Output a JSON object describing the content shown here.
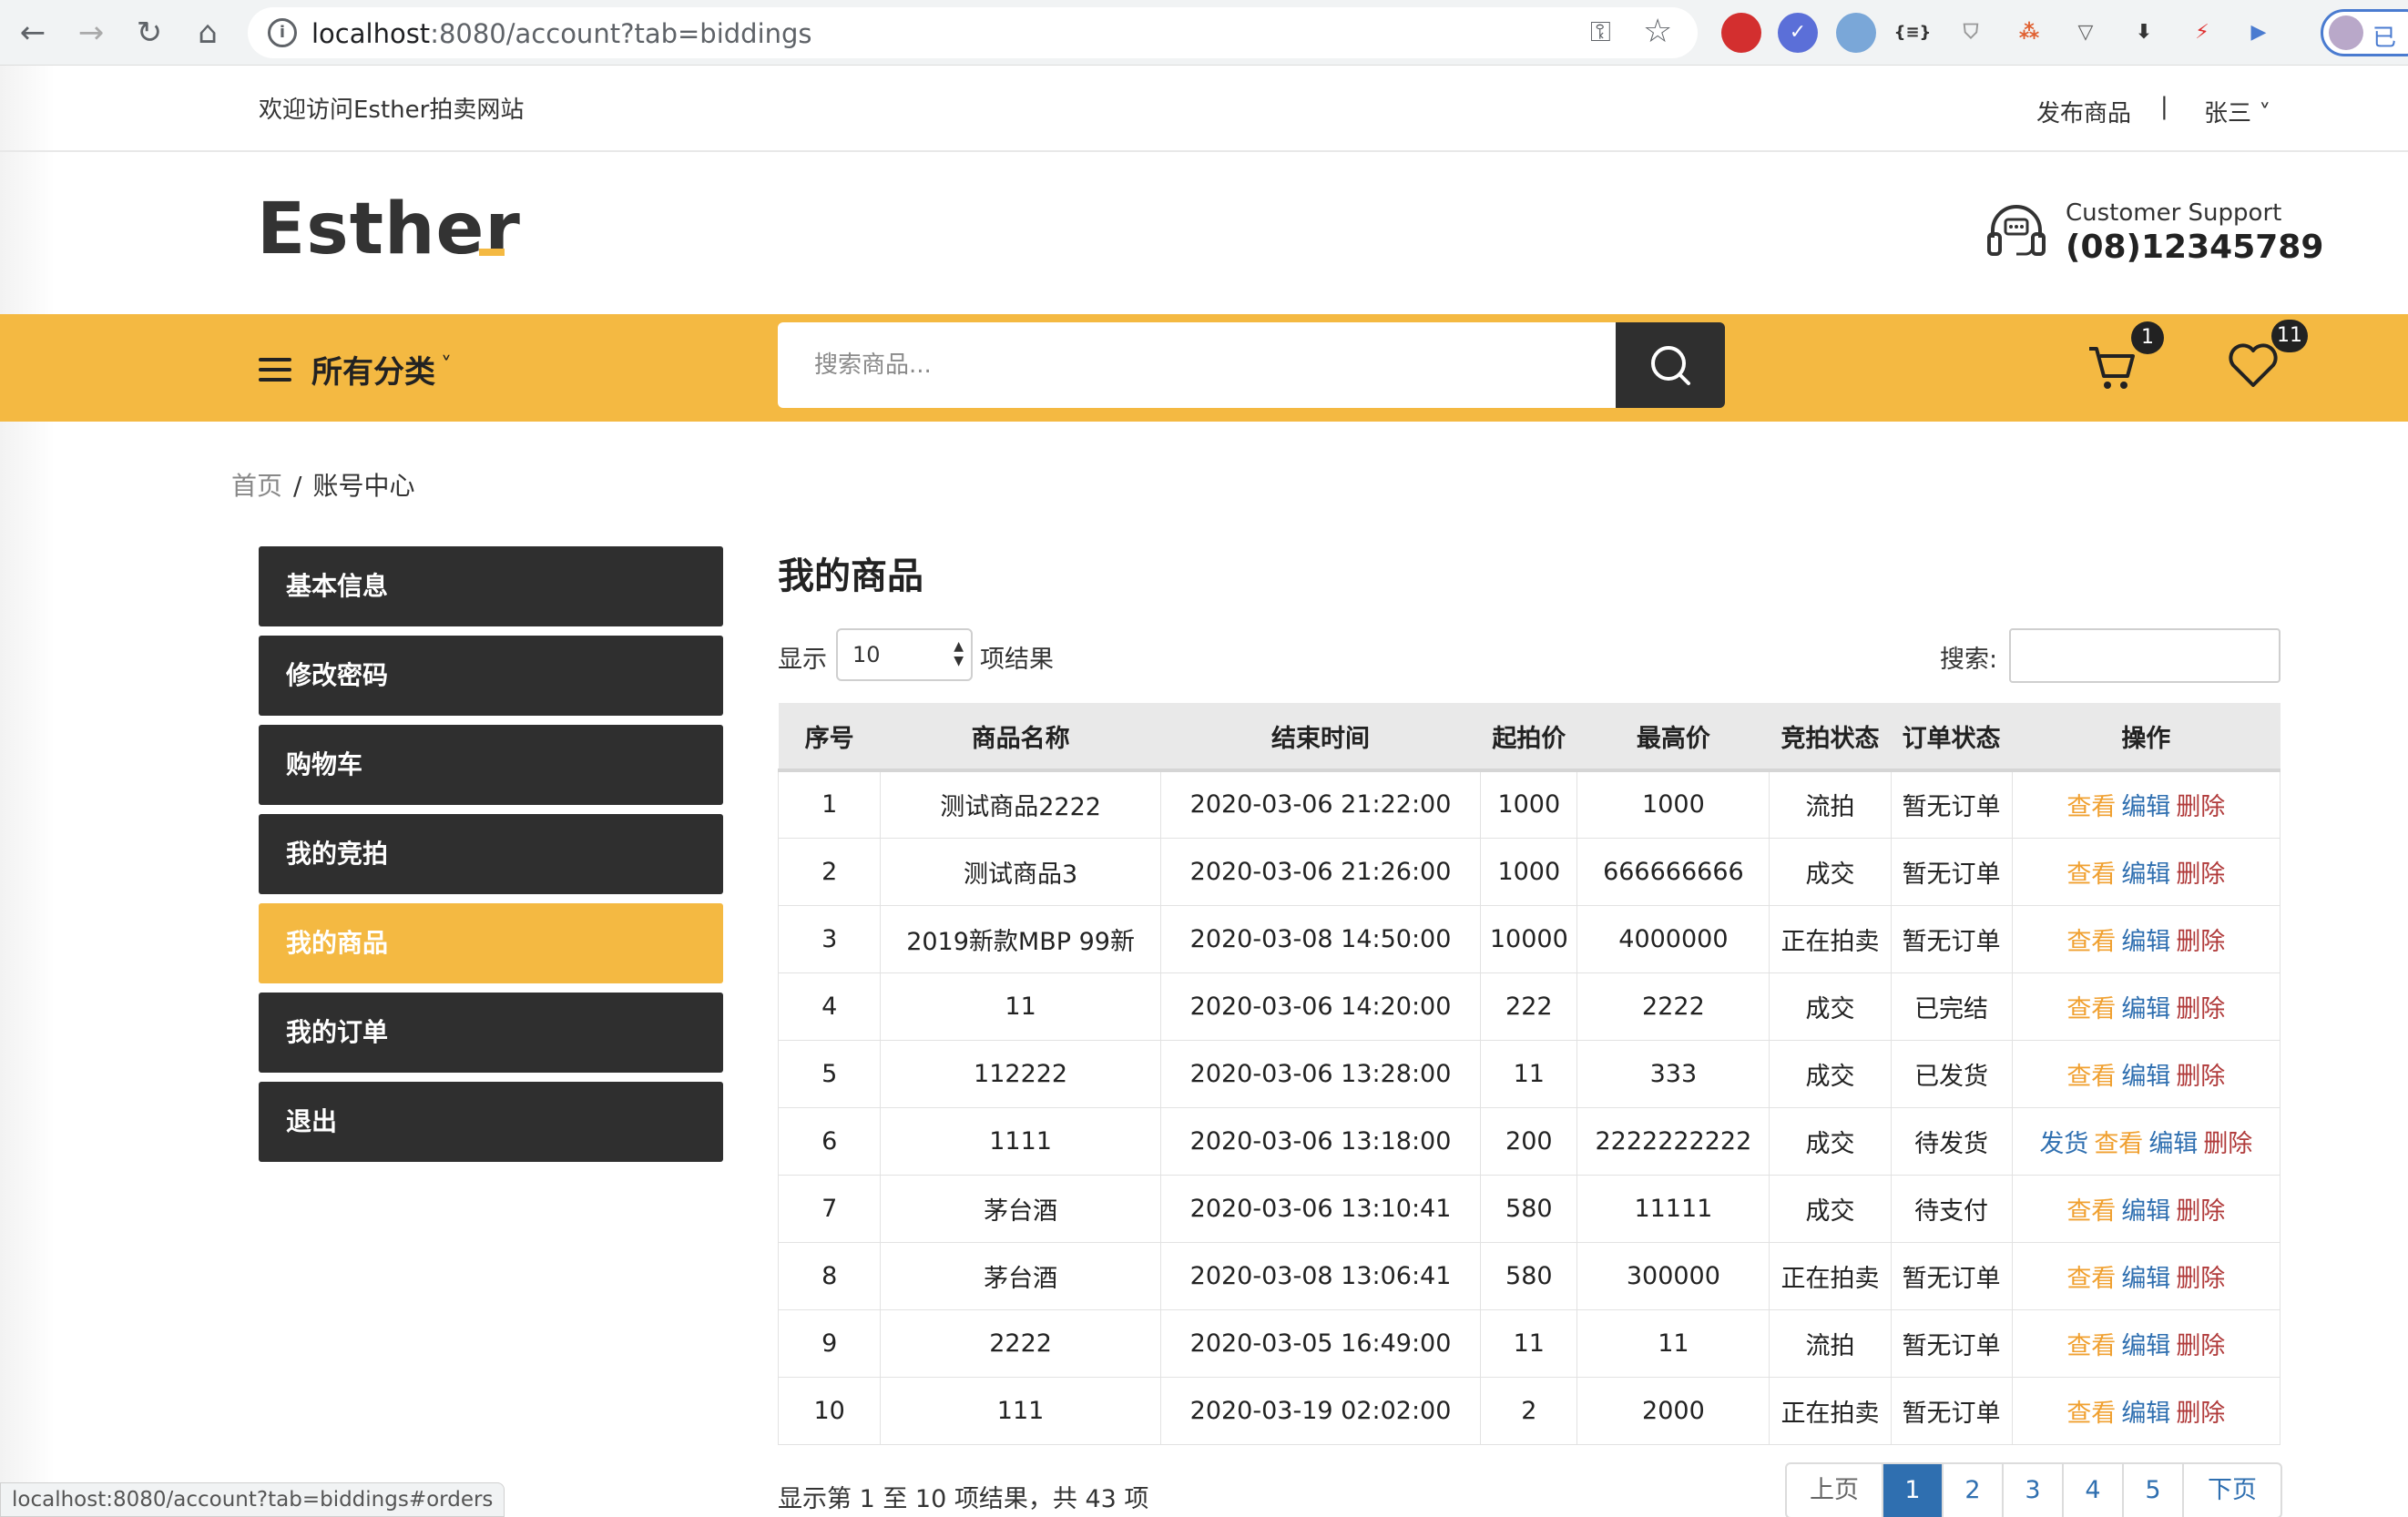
{
  "browser": {
    "url_host": "localhost",
    "url_rest": ":8080/account?tab=biddings",
    "profile_text": "已"
  },
  "topbar": {
    "welcome": "欢迎访问Esther拍卖网站",
    "publish": "发布商品",
    "separator": "|",
    "user": "张三 ˅"
  },
  "header": {
    "logo": "Esther",
    "support_label": "Customer Support",
    "support_phone": "(08)12345789"
  },
  "nav": {
    "categories": "所有分类",
    "caret": "˅",
    "search_placeholder": "搜索商品...",
    "cart_count": "1",
    "wishlist_count": "11"
  },
  "breadcrumb": {
    "home": "首页",
    "sep": "/",
    "current": "账号中心"
  },
  "sidebar": {
    "items": [
      "基本信息",
      "修改密码",
      "购物车",
      "我的竞拍",
      "我的商品",
      "我的订单",
      "退出"
    ],
    "active_index": 4
  },
  "content": {
    "title": "我的商品",
    "show_label": "显示",
    "page_size": "10",
    "show_suffix": "项结果",
    "filter_label": "搜索:",
    "columns": [
      "序号",
      "商品名称",
      "结束时间",
      "起拍价",
      "最高价",
      "竞拍状态",
      "订单状态",
      "操作"
    ],
    "rows": [
      {
        "no": "1",
        "name": "测试商品2222",
        "end": "2020-03-06 21:22:00",
        "start": "1000",
        "max": "1000",
        "bid": "流拍",
        "bid_class": "st-red",
        "order": "暂无订单",
        "order_class": "st-red",
        "ship": ""
      },
      {
        "no": "2",
        "name": "测试商品3",
        "end": "2020-03-06 21:26:00",
        "start": "1000",
        "max": "666666666",
        "bid": "成交",
        "bid_class": "st-green",
        "order": "暂无订单",
        "order_class": "st-red",
        "ship": ""
      },
      {
        "no": "3",
        "name": "2019新款MBP 99新",
        "end": "2020-03-08 14:50:00",
        "start": "10000",
        "max": "4000000",
        "bid": "正在拍卖",
        "bid_class": "st-blue",
        "order": "暂无订单",
        "order_class": "st-red",
        "ship": ""
      },
      {
        "no": "4",
        "name": "11",
        "end": "2020-03-06 14:20:00",
        "start": "222",
        "max": "2222",
        "bid": "成交",
        "bid_class": "st-green",
        "order": "已完结",
        "order_class": "st-green",
        "ship": ""
      },
      {
        "no": "5",
        "name": "112222",
        "end": "2020-03-06 13:28:00",
        "start": "11",
        "max": "333",
        "bid": "成交",
        "bid_class": "st-green",
        "order": "已发货",
        "order_class": "st-blue",
        "ship": ""
      },
      {
        "no": "6",
        "name": "1111",
        "end": "2020-03-06 13:18:00",
        "start": "200",
        "max": "2222222222",
        "bid": "成交",
        "bid_class": "st-green",
        "order": "待发货",
        "order_class": "st-blue",
        "ship": "发货"
      },
      {
        "no": "7",
        "name": "茅台酒",
        "end": "2020-03-06 13:10:41",
        "start": "580",
        "max": "11111",
        "bid": "成交",
        "bid_class": "st-green",
        "order": "待支付",
        "order_class": "st-blue",
        "ship": ""
      },
      {
        "no": "8",
        "name": "茅台酒",
        "end": "2020-03-08 13:06:41",
        "start": "580",
        "max": "300000",
        "bid": "正在拍卖",
        "bid_class": "st-blue",
        "order": "暂无订单",
        "order_class": "st-red",
        "ship": ""
      },
      {
        "no": "9",
        "name": "2222",
        "end": "2020-03-05 16:49:00",
        "start": "11",
        "max": "11",
        "bid": "流拍",
        "bid_class": "st-red",
        "order": "暂无订单",
        "order_class": "st-red",
        "ship": ""
      },
      {
        "no": "10",
        "name": "111",
        "end": "2020-03-19 02:02:00",
        "start": "2",
        "max": "2000",
        "bid": "正在拍卖",
        "bid_class": "st-blue",
        "order": "暂无订单",
        "order_class": "st-red",
        "ship": ""
      }
    ],
    "actions": {
      "view": "查看",
      "edit": "编辑",
      "delete": "删除"
    },
    "info": "显示第 1 至 10 项结果，共 43 项",
    "pager": {
      "prev": "上页",
      "pages": [
        "1",
        "2",
        "3",
        "4",
        "5"
      ],
      "current": "1",
      "next": "下页"
    }
  },
  "status_url": "localhost:8080/account?tab=biddings#orders",
  "colors": {
    "accent": "#f4b942",
    "dark": "#2f2f2f",
    "link_blue": "#2f6fb0"
  }
}
